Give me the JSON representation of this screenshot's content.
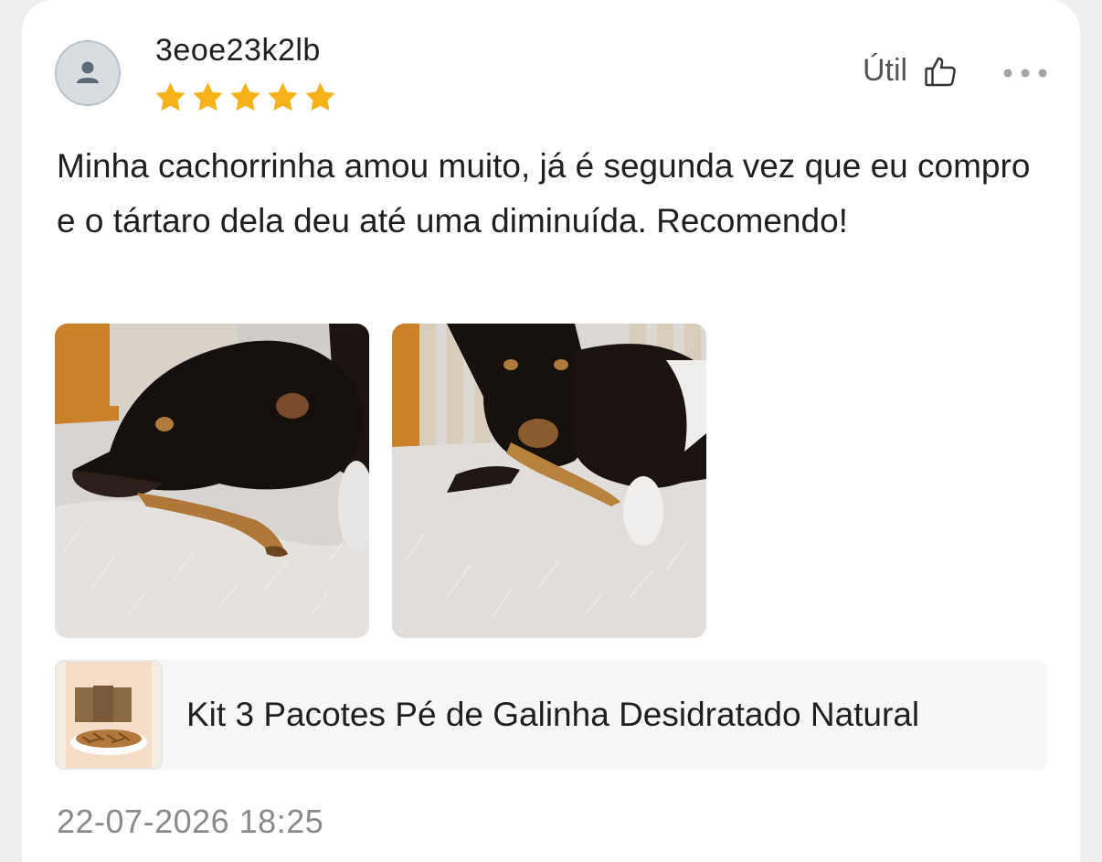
{
  "review": {
    "username": "3eoe23k2lb",
    "rating": 5,
    "text": "Minha cachorrinha amou muito, já é segunda vez que eu compro e o tártaro dela deu até uma diminuída. Recomendo!",
    "helpful_label": "Útil",
    "timestamp": "22-07-2026 18:25",
    "photos": [
      "dog-chewing-photo-1",
      "dog-chewing-photo-2"
    ]
  },
  "product": {
    "name": "Kit 3 Pacotes Pé de Galinha Desidratado Natural"
  },
  "icons": {
    "avatar": "user-icon",
    "helpful": "thumbs-up-icon",
    "more": "more-options-icon",
    "star": "star-icon"
  },
  "colors": {
    "star": "#f8b219",
    "card": "#ffffff",
    "background": "#efefef",
    "timestamp": "#8a8a8a"
  }
}
